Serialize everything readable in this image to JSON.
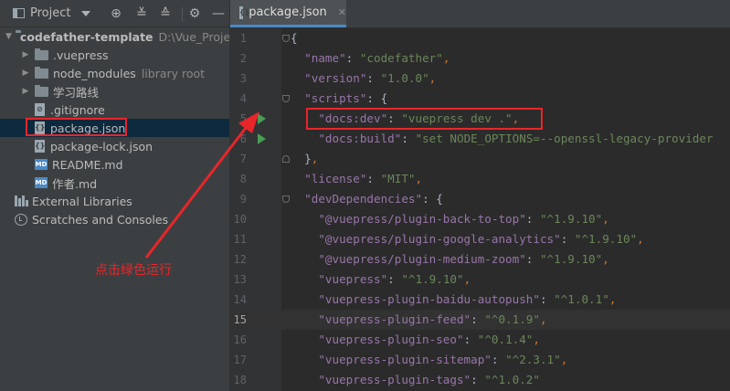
{
  "project_panel": {
    "title": "Project",
    "toolbar_icons": [
      "locate-icon",
      "expand-all-icon",
      "collapse-all-icon",
      "settings-icon",
      "hide-icon"
    ],
    "tree": [
      {
        "label": "codefather-template",
        "hint": "D:\\Vue_Proje",
        "type": "root-folder",
        "depth": 0,
        "expanded": true
      },
      {
        "label": ".vuepress",
        "type": "folder",
        "depth": 1
      },
      {
        "label": "node_modules",
        "hint": "library root",
        "type": "folder",
        "depth": 1
      },
      {
        "label": "学习路线",
        "type": "folder",
        "depth": 1
      },
      {
        "label": ".gitignore",
        "type": "file",
        "depth": 1
      },
      {
        "label": "package.json",
        "type": "json",
        "depth": 1,
        "selected": true
      },
      {
        "label": "package-lock.json",
        "type": "json",
        "depth": 1
      },
      {
        "label": "README.md",
        "type": "md",
        "depth": 1
      },
      {
        "label": "作者.md",
        "type": "md",
        "depth": 1
      },
      {
        "label": "External Libraries",
        "type": "libraries",
        "depth": 0
      },
      {
        "label": "Scratches and Consoles",
        "type": "scratches",
        "depth": 0
      }
    ]
  },
  "annotation": {
    "text": "点击绿色运行",
    "color": "#e8262a"
  },
  "editor": {
    "tab_label": "package.json",
    "current_line": 15,
    "lines": [
      {
        "n": "1",
        "tokens": [
          [
            "b",
            "{"
          ]
        ]
      },
      {
        "n": "2",
        "tokens": [
          [
            "k",
            "  \"name\""
          ],
          [
            "b",
            ": "
          ],
          [
            "v",
            "\"codefather\""
          ],
          [
            "p",
            ","
          ]
        ]
      },
      {
        "n": "3",
        "tokens": [
          [
            "k",
            "  \"version\""
          ],
          [
            "b",
            ": "
          ],
          [
            "v",
            "\"1.0.0\""
          ],
          [
            "p",
            ","
          ]
        ]
      },
      {
        "n": "4",
        "tokens": [
          [
            "k",
            "  \"scripts\""
          ],
          [
            "b",
            ": {"
          ]
        ]
      },
      {
        "n": "5",
        "tokens": [
          [
            "k",
            "    \"docs:dev\""
          ],
          [
            "b",
            ": "
          ],
          [
            "v",
            "\"vuepress dev .\""
          ],
          [
            "p",
            ","
          ]
        ],
        "run": true
      },
      {
        "n": "6",
        "tokens": [
          [
            "k",
            "    \"docs:build\""
          ],
          [
            "b",
            ": "
          ],
          [
            "v",
            "\"set NODE_OPTIONS=--openssl-legacy-provider"
          ]
        ],
        "run": true
      },
      {
        "n": "7",
        "tokens": [
          [
            "b",
            "  }"
          ],
          [
            "p",
            ","
          ]
        ]
      },
      {
        "n": "8",
        "tokens": [
          [
            "k",
            "  \"license\""
          ],
          [
            "b",
            ": "
          ],
          [
            "v",
            "\"MIT\""
          ],
          [
            "p",
            ","
          ]
        ]
      },
      {
        "n": "9",
        "tokens": [
          [
            "k",
            "  \"devDependencies\""
          ],
          [
            "b",
            ": {"
          ]
        ]
      },
      {
        "n": "10",
        "tokens": [
          [
            "k",
            "    \"@vuepress/plugin-back-to-top\""
          ],
          [
            "b",
            ": "
          ],
          [
            "v",
            "\"^1.9.10\""
          ],
          [
            "p",
            ","
          ]
        ]
      },
      {
        "n": "11",
        "tokens": [
          [
            "k",
            "    \"@vuepress/plugin-google-analytics\""
          ],
          [
            "b",
            ": "
          ],
          [
            "v",
            "\"^1.9.10\""
          ],
          [
            "p",
            ","
          ]
        ]
      },
      {
        "n": "12",
        "tokens": [
          [
            "k",
            "    \"@vuepress/plugin-medium-zoom\""
          ],
          [
            "b",
            ": "
          ],
          [
            "v",
            "\"^1.9.10\""
          ],
          [
            "p",
            ","
          ]
        ]
      },
      {
        "n": "13",
        "tokens": [
          [
            "k",
            "    \"vuepress\""
          ],
          [
            "b",
            ": "
          ],
          [
            "v",
            "\"^1.9.10\""
          ],
          [
            "p",
            ","
          ]
        ]
      },
      {
        "n": "14",
        "tokens": [
          [
            "k",
            "    \"vuepress-plugin-baidu-autopush\""
          ],
          [
            "b",
            ": "
          ],
          [
            "v",
            "\"^1.0.1\""
          ],
          [
            "p",
            ","
          ]
        ]
      },
      {
        "n": "15",
        "tokens": [
          [
            "k",
            "    \"vuepress-plugin-feed\""
          ],
          [
            "b",
            ": "
          ],
          [
            "v",
            "\"^0.1.9\""
          ],
          [
            "p",
            ","
          ]
        ]
      },
      {
        "n": "16",
        "tokens": [
          [
            "k",
            "    \"vuepress-plugin-seo\""
          ],
          [
            "b",
            ": "
          ],
          [
            "v",
            "\"^0.1.4\""
          ],
          [
            "p",
            ","
          ]
        ]
      },
      {
        "n": "17",
        "tokens": [
          [
            "k",
            "    \"vuepress-plugin-sitemap\""
          ],
          [
            "b",
            ": "
          ],
          [
            "v",
            "\"^2.3.1\""
          ],
          [
            "p",
            ","
          ]
        ]
      },
      {
        "n": "18",
        "tokens": [
          [
            "k",
            "    \"vuepress-plugin-tags\""
          ],
          [
            "b",
            ": "
          ],
          [
            "v",
            "\"^1.0.2\""
          ]
        ]
      }
    ]
  }
}
